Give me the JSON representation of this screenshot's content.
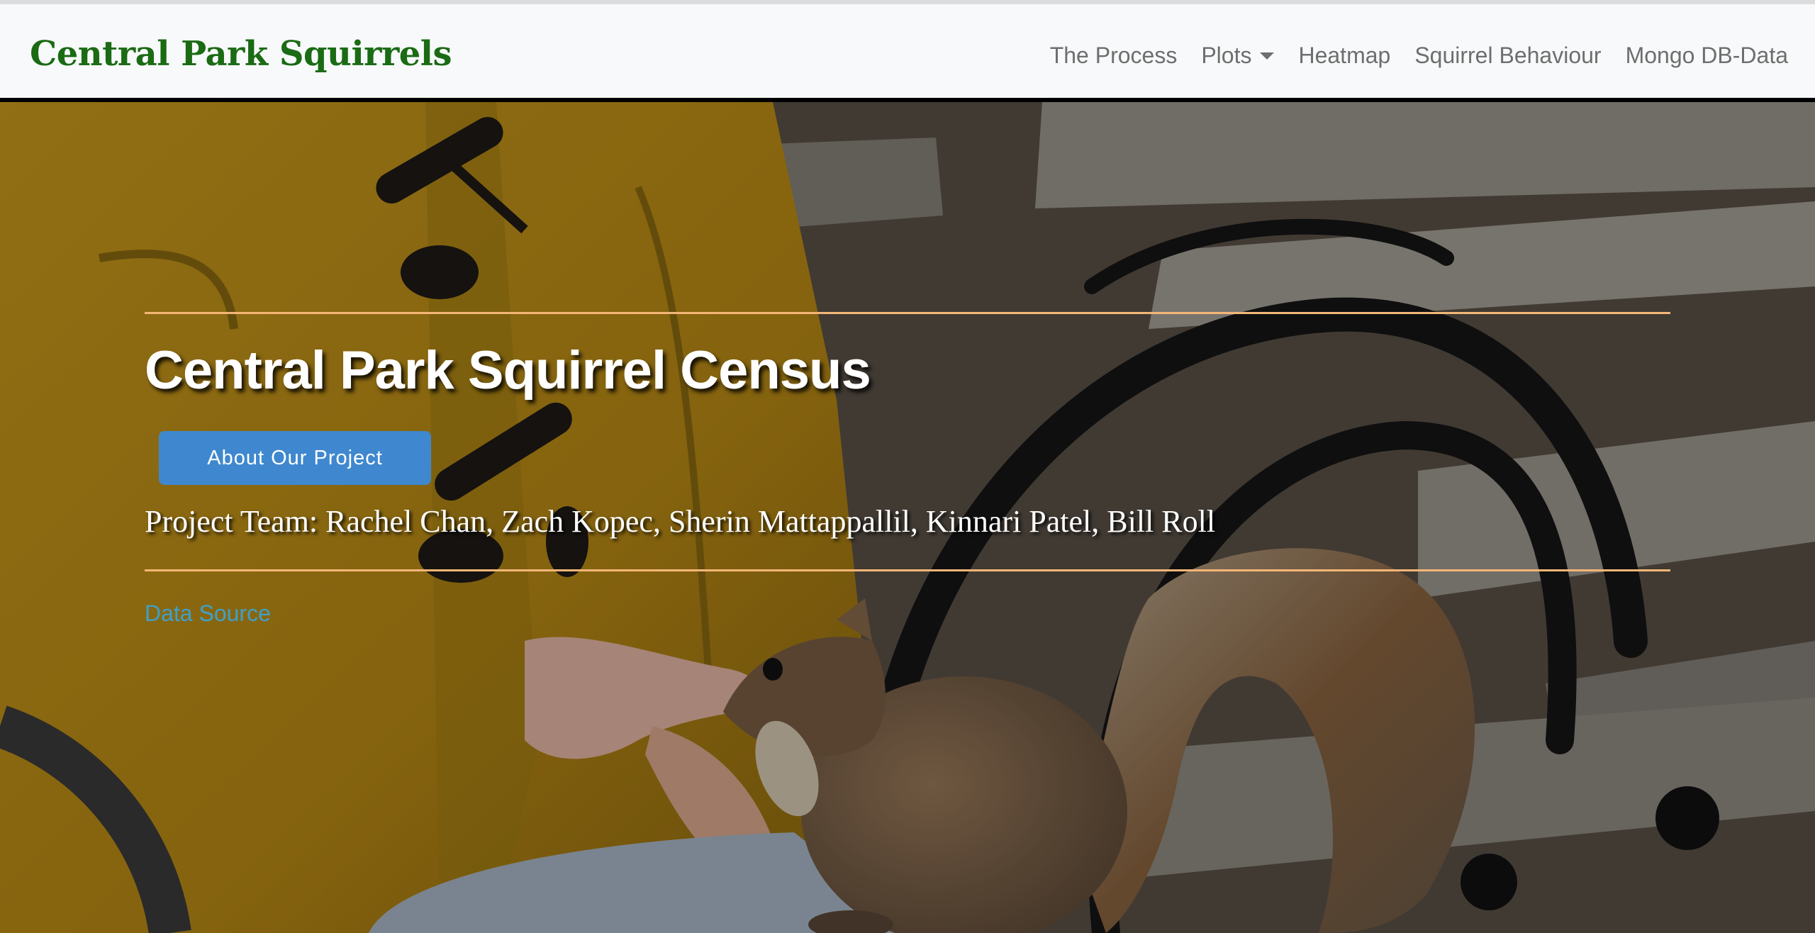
{
  "navbar": {
    "brand": "Central Park Squirrels",
    "links": {
      "process": "The Process",
      "plots": "Plots",
      "heatmap": "Heatmap",
      "behaviour": "Squirrel Behaviour",
      "mongo": "Mongo DB-Data"
    }
  },
  "hero": {
    "title": "Central Park Squirrel Census",
    "button_label": "About Our Project",
    "team": "Project Team: Rachel Chan, Zach Kopec, Sherin Mattappallil, Kinnari Patel, Bill Roll",
    "data_source_link": "Data Source",
    "background_image": "squirrel-on-bench-photo"
  },
  "colors": {
    "brand": "#1a6b14",
    "accent_rule": "#f3b676",
    "button": "#3f88cf",
    "link": "#3fa0c8",
    "nav_text": "#6e6e6e",
    "navbar_bg": "#f8f9fa"
  }
}
